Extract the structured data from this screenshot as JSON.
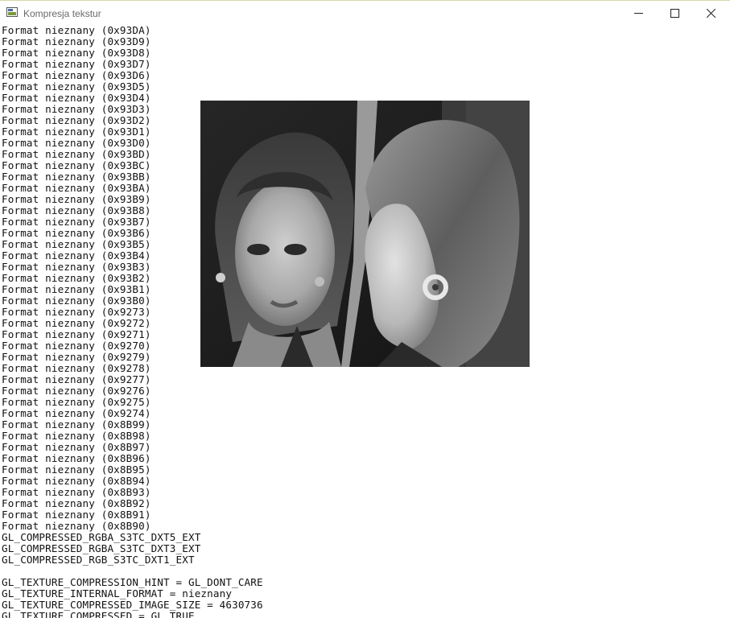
{
  "window": {
    "title": "Kompresja tekstur",
    "app_icon": "window-app-icon",
    "controls": {
      "minimize": "minimize-icon",
      "maximize": "maximize-icon",
      "close": "close-icon"
    }
  },
  "console": {
    "lines": [
      "Format nieznany (0x93DA)",
      "Format nieznany (0x93D9)",
      "Format nieznany (0x93D8)",
      "Format nieznany (0x93D7)",
      "Format nieznany (0x93D6)",
      "Format nieznany (0x93D5)",
      "Format nieznany (0x93D4)",
      "Format nieznany (0x93D3)",
      "Format nieznany (0x93D2)",
      "Format nieznany (0x93D1)",
      "Format nieznany (0x93D0)",
      "Format nieznany (0x93BD)",
      "Format nieznany (0x93BC)",
      "Format nieznany (0x93BB)",
      "Format nieznany (0x93BA)",
      "Format nieznany (0x93B9)",
      "Format nieznany (0x93B8)",
      "Format nieznany (0x93B7)",
      "Format nieznany (0x93B6)",
      "Format nieznany (0x93B5)",
      "Format nieznany (0x93B4)",
      "Format nieznany (0x93B3)",
      "Format nieznany (0x93B2)",
      "Format nieznany (0x93B1)",
      "Format nieznany (0x93B0)",
      "Format nieznany (0x9273)",
      "Format nieznany (0x9272)",
      "Format nieznany (0x9271)",
      "Format nieznany (0x9270)",
      "Format nieznany (0x9279)",
      "Format nieznany (0x9278)",
      "Format nieznany (0x9277)",
      "Format nieznany (0x9276)",
      "Format nieznany (0x9275)",
      "Format nieznany (0x9274)",
      "Format nieznany (0x8B99)",
      "Format nieznany (0x8B98)",
      "Format nieznany (0x8B97)",
      "Format nieznany (0x8B96)",
      "Format nieznany (0x8B95)",
      "Format nieznany (0x8B94)",
      "Format nieznany (0x8B93)",
      "Format nieznany (0x8B92)",
      "Format nieznany (0x8B91)",
      "Format nieznany (0x8B90)",
      "GL_COMPRESSED_RGBA_S3TC_DXT5_EXT",
      "GL_COMPRESSED_RGBA_S3TC_DXT3_EXT",
      "GL_COMPRESSED_RGB_S3TC_DXT1_EXT",
      "",
      "GL_TEXTURE_COMPRESSION_HINT = GL_DONT_CARE",
      "GL_TEXTURE_INTERNAL_FORMAT = nieznany",
      "GL_TEXTURE_COMPRESSED_IMAGE_SIZE = 4630736",
      "GL_TEXTURE_COMPRESSED = GL_TRUE"
    ]
  },
  "texture": {
    "description_icon": "grayscale-texture-image",
    "colors": {
      "background": "#1e1e1e",
      "skin": "#b5b5b5",
      "hair": "#5a5a5a"
    }
  }
}
